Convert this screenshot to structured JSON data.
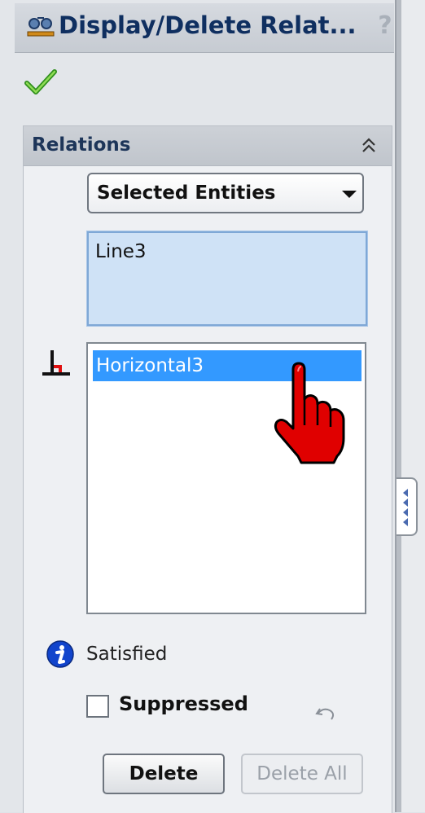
{
  "title_bar": {
    "title": "Display/Delete Relat...",
    "help_label": "?"
  },
  "relations": {
    "section_title": "Relations",
    "filter": {
      "selected": "Selected Entities"
    },
    "selected_entities": [
      "Line3"
    ],
    "relations_list": [
      {
        "label": "Horizontal3",
        "selected": true,
        "icon": "horizontal-relation-icon"
      }
    ],
    "status": {
      "icon": "info-icon",
      "text": "Satisfied"
    },
    "suppressed": {
      "label": "Suppressed",
      "checked": false
    },
    "buttons": {
      "delete": "Delete",
      "delete_all": "Delete All"
    }
  },
  "colors": {
    "selection": "#3399ff",
    "entities_bg": "#cfe2f6",
    "title_text": "#0f2f60",
    "cursor": "#e00000"
  }
}
